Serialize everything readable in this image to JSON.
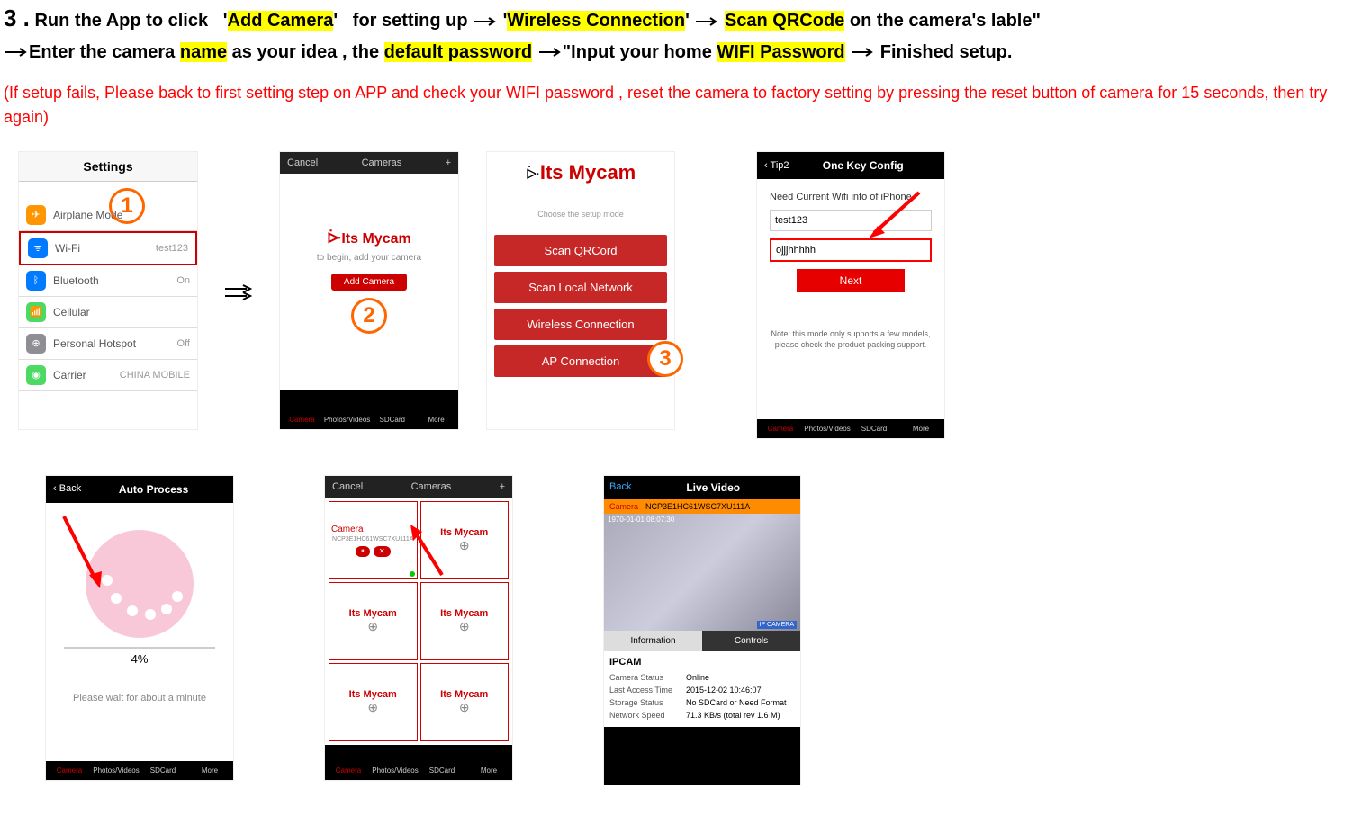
{
  "step_number": "3 .",
  "instruction": {
    "run_app": "Run the App to click",
    "add_camera": "Add Camera",
    "for_setting": "for setting up",
    "wireless": "Wireless Connection",
    "scan_qr": "Scan QRCode",
    "on_label": "on the camera's lable\"",
    "enter_name_pre": "Enter the camera",
    "name": "name",
    "enter_name_post": "as your idea , the",
    "default_pw": "default password",
    "input_wifi_pre": "\"Input your home",
    "wifi_pw": "WIFI Password",
    "finished": "Finished    setup."
  },
  "warning_text": "(If setup fails, Please back to first setting step on APP and check your WIFI password , reset the camera to factory setting by pressing the reset button of camera for 15 seconds, then try    again)",
  "phone1": {
    "header": "Settings",
    "airplane": "Airplane Mode",
    "wifi": "Wi-Fi",
    "wifi_val": "test123",
    "bt": "Bluetooth",
    "bt_val": "On",
    "cell": "Cellular",
    "hotspot": "Personal Hotspot",
    "hotspot_val": "Off",
    "carrier": "Carrier",
    "carrier_val": "CHINA MOBILE"
  },
  "phone2": {
    "cancel": "Cancel",
    "title": "Cameras",
    "plus": "+",
    "logo": "Its Mycam",
    "sub": "to begin, add your camera",
    "btn": "Add Camera",
    "tabs": [
      "Camera",
      "Photos/Videos",
      "SDCard",
      "More"
    ]
  },
  "phone3": {
    "logo": "Its Mycam",
    "sub": "Choose the setup mode",
    "b1": "Scan QRCord",
    "b2": "Scan Local Network",
    "b3": "Wireless Connection",
    "b4": "AP Connection"
  },
  "phone4": {
    "back": "Tip2",
    "title": "One Key Config",
    "note": "Need Current Wifi info of iPhone",
    "ssid": "test123",
    "pw": "ojjjhhhhh",
    "next": "Next",
    "small": "Note: this mode only supports a few models, please check the product packing support.",
    "tabs": [
      "Camera",
      "Photos/Videos",
      "SDCard",
      "More"
    ]
  },
  "phone5": {
    "back": "Back",
    "title": "Auto Process",
    "pct": "4%",
    "wait": "Please wait for about a minute",
    "tabs": [
      "Camera",
      "Photos/Videos",
      "SDCard",
      "More"
    ]
  },
  "phone6": {
    "cancel": "Cancel",
    "title": "Cameras",
    "plus": "+",
    "cam_name": "Camera",
    "cam_id": "NCP3E1HC61WSC7XU111A",
    "logo": "Its Mycam",
    "tabs": [
      "Camera",
      "Photos/Videos",
      "SDCard",
      "More"
    ]
  },
  "phone7": {
    "back": "Back",
    "title": "Live Video",
    "cam": "Camera",
    "cam_id": "NCP3E1HC61WSC7XU111A",
    "ts": "1970-01-01 08:07:30",
    "wm": "IP  CAMERA",
    "tab_info": "Information",
    "tab_ctrl": "Controls",
    "ipcam": "IPCAM",
    "r1k": "Camera Status",
    "r1v": "Online",
    "r2k": "Last Access Time",
    "r2v": "2015-12-02 10:46:07",
    "r3k": "Storage Status",
    "r3v": "No SDCard or Need Format",
    "r4k": "Network Speed",
    "r4v": "71.3 KB/s (total rev 1.6 M)"
  },
  "circles": {
    "c1": "1",
    "c2": "2",
    "c3": "3"
  }
}
